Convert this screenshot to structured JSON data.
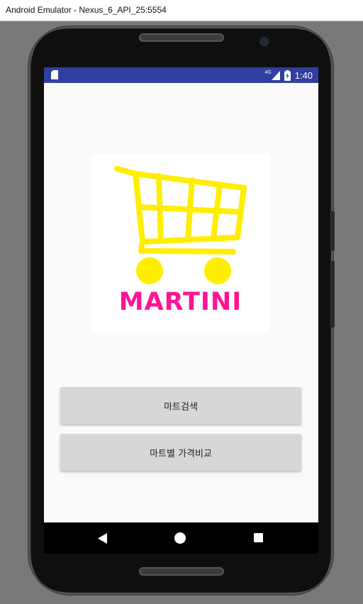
{
  "window": {
    "title": "Android Emulator - Nexus_6_API_25:5554"
  },
  "status_bar": {
    "time": "1:40",
    "network": "4G",
    "color": "#303f9f"
  },
  "logo": {
    "text": "MARTINI",
    "cart_color": "#ffee00",
    "text_color": "#ff1493"
  },
  "buttons": [
    {
      "label": "마트검색"
    },
    {
      "label": "마트별 가격비교"
    }
  ],
  "nav": {
    "back": "back-icon",
    "home": "home-icon",
    "recents": "recents-icon"
  }
}
